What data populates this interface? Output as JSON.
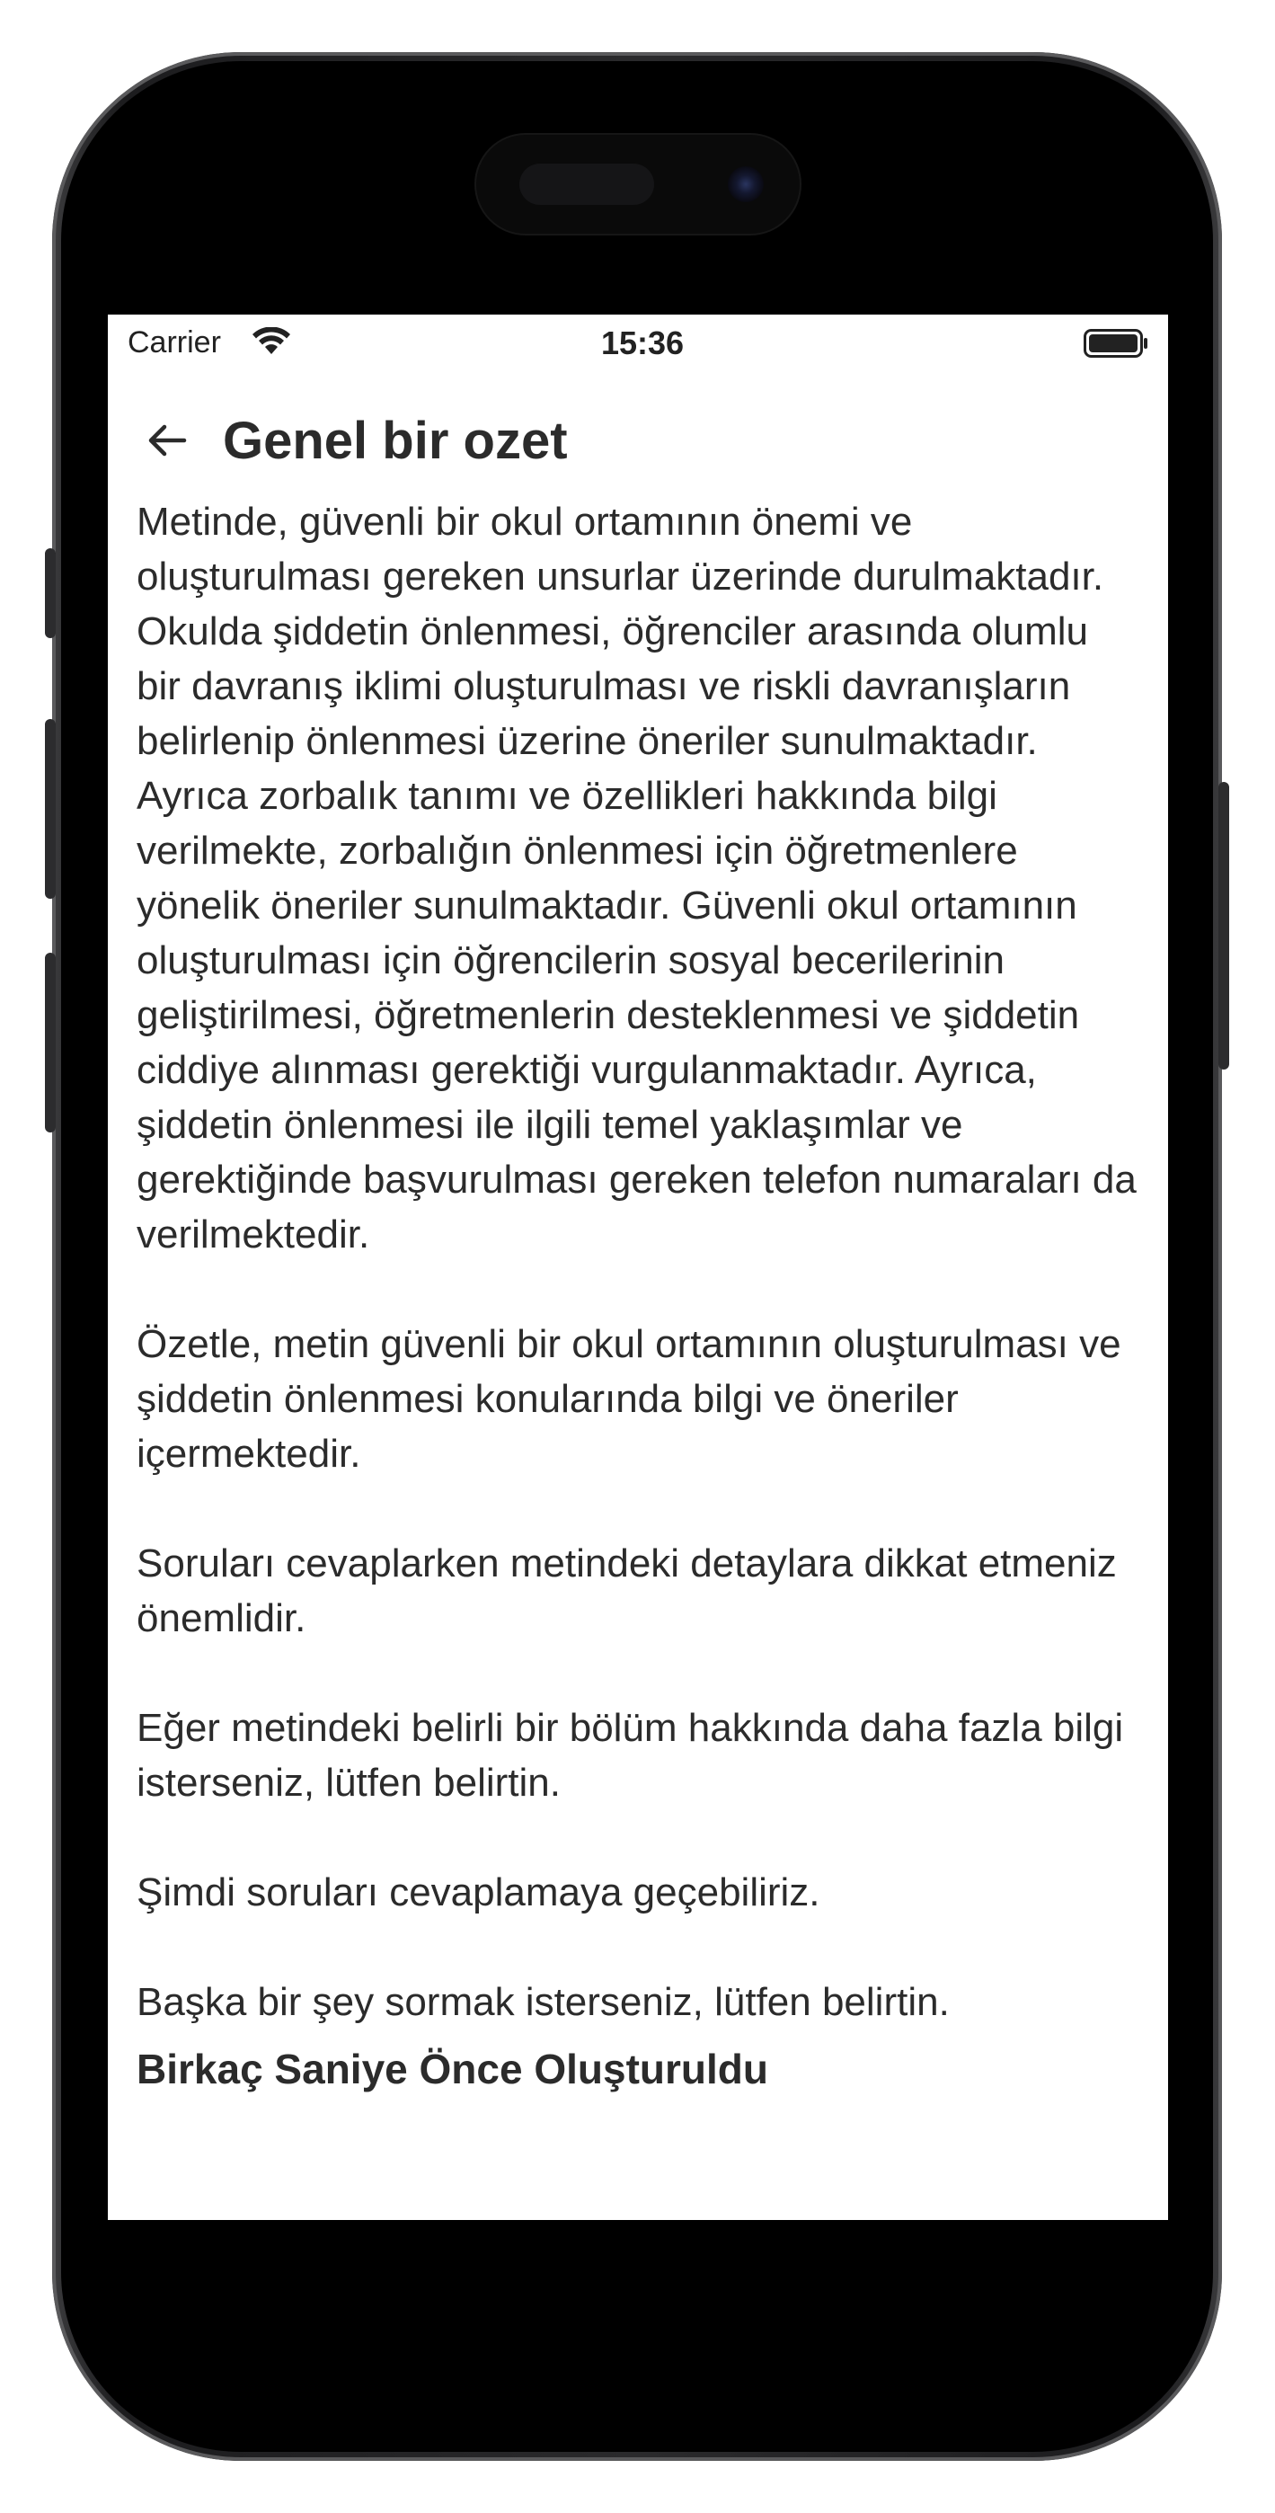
{
  "status_bar": {
    "carrier": "Carrier",
    "time": "15:36",
    "wifi_icon": "wifi-icon",
    "battery_icon": "battery-full-icon"
  },
  "nav": {
    "back_icon": "arrow-left-icon",
    "title": "Genel bir ozet"
  },
  "content": {
    "paragraphs": [
      "Metinde, güvenli bir okul ortamının önemi ve oluşturulması gereken unsurlar üzerinde durulmaktadır. Okulda şiddetin önlenmesi, öğrenciler arasında olumlu bir davranış iklimi oluşturulması ve riskli davranışların belirlenip önlenmesi üzerine öneriler sunulmaktadır. Ayrıca zorbalık tanımı ve özellikleri hakkında bilgi verilmekte, zorbalığın önlenmesi için öğretmenlere yönelik öneriler sunulmaktadır. Güvenli okul ortamının oluşturulması için öğrencilerin sosyal becerilerinin geliştirilmesi, öğretmenlerin desteklenmesi ve şiddetin ciddiye alınması gerektiği vurgulanmaktadır. Ayrıca, şiddetin önlenmesi ile ilgili temel yaklaşımlar ve gerektiğinde başvurulması gereken telefon numaraları da verilmektedir.",
      "Özetle, metin güvenli bir okul ortamının oluşturulması ve şiddetin önlenmesi konularında bilgi ve öneriler içermektedir.",
      "Soruları cevaplarken metindeki detaylara dikkat etmeniz önemlidir.",
      "Eğer metindeki belirli bir bölüm hakkında daha fazla bilgi isterseniz, lütfen belirtin.",
      "Şimdi soruları cevaplamaya geçebiliriz.",
      "Başka bir şey sormak isterseniz, lütfen belirtin."
    ],
    "generated_note": "Birkaç Saniye Önce Oluşturuldu"
  },
  "colors": {
    "text": "#2b2b2b",
    "background": "#ffffff",
    "frame": "#1c1c1e"
  }
}
